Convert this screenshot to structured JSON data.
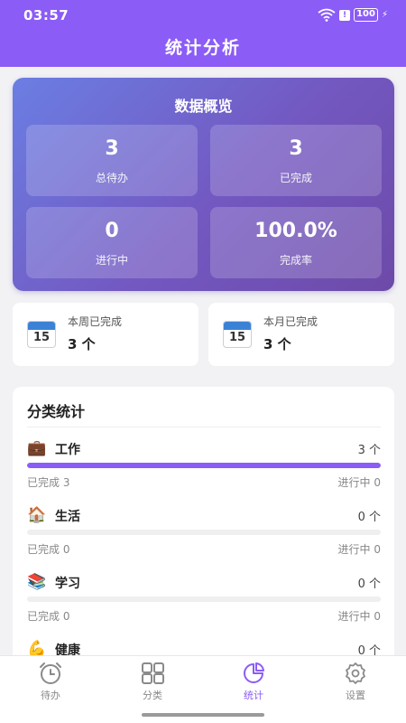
{
  "status": {
    "time": "03:57",
    "alert": "!",
    "battery": "100",
    "charging_glyph": "⚡"
  },
  "header": {
    "title": "统计分析"
  },
  "overview": {
    "title": "数据概览",
    "stats": [
      {
        "value": "3",
        "label": "总待办"
      },
      {
        "value": "3",
        "label": "已完成"
      },
      {
        "value": "0",
        "label": "进行中"
      },
      {
        "value": "100.0%",
        "label": "完成率"
      }
    ]
  },
  "week": {
    "label": "本周已完成",
    "value": "3 个",
    "cal_day": "15",
    "icon": "calendar-icon"
  },
  "month": {
    "label": "本月已完成",
    "value": "3 个",
    "cal_day": "15",
    "icon": "calendar-icon"
  },
  "categories": {
    "title": "分类统计",
    "items": [
      {
        "icon": "💼",
        "icon_name": "briefcase-icon",
        "name": "工作",
        "count": "3 个",
        "progress": 1.0,
        "done": "已完成 3",
        "in_progress": "进行中 0"
      },
      {
        "icon": "🏠",
        "icon_name": "house-icon",
        "name": "生活",
        "count": "0 个",
        "progress": 0,
        "done": "已完成 0",
        "in_progress": "进行中 0"
      },
      {
        "icon": "📚",
        "icon_name": "books-icon",
        "name": "学习",
        "count": "0 个",
        "progress": 0,
        "done": "已完成 0",
        "in_progress": "进行中 0"
      },
      {
        "icon": "💪",
        "icon_name": "flexed-arm-icon",
        "name": "健康",
        "count": "0 个",
        "progress": 0,
        "done": "",
        "in_progress": ""
      }
    ]
  },
  "tabbar": {
    "accent": "#8b5cf6",
    "inactive_color": "#8a8a8a",
    "tabs": [
      {
        "label": "待办",
        "icon": "alarm-clock-icon",
        "active": false
      },
      {
        "label": "分类",
        "icon": "grid-icon",
        "active": false
      },
      {
        "label": "统计",
        "icon": "pie-chart-icon",
        "active": true
      },
      {
        "label": "设置",
        "icon": "gear-icon",
        "active": false
      }
    ]
  }
}
